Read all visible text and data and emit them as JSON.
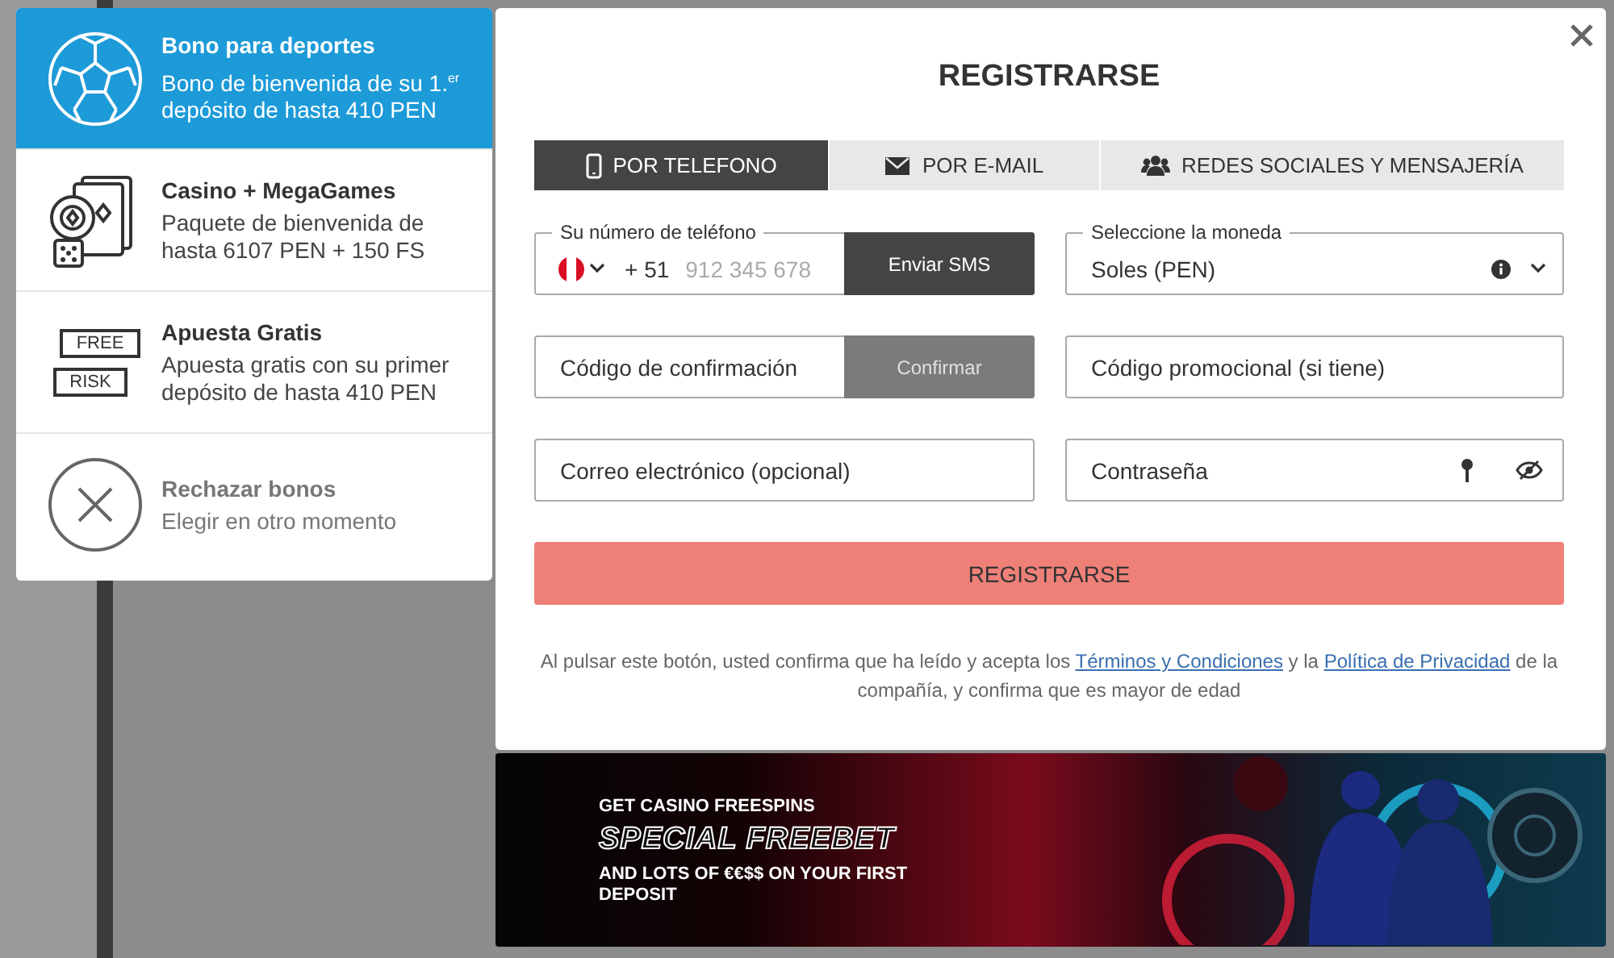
{
  "bonus_options": [
    {
      "kind": "sports",
      "title": "Bono para deportes",
      "description": "Bono de bienvenida de su 1.$^{er}$ depósito de hasta 410 PEN",
      "selected": true
    },
    {
      "kind": "casino",
      "title": "Casino + MegaGames",
      "description": "Paquete de bienvenida de hasta 6107 PEN + 150 FS",
      "selected": false
    },
    {
      "kind": "freebet",
      "title": "Apuesta Gratis",
      "description": "Apuesta gratis con su primer depósito de hasta 410 PEN",
      "selected": false,
      "icon_labels": [
        "FREE",
        "RISK"
      ]
    },
    {
      "kind": "decline",
      "title": "Rechazar bonos",
      "description": "Elegir en otro momento",
      "selected": false
    }
  ],
  "modal": {
    "title": "REGISTRARSE",
    "tabs": [
      {
        "label": "POR TELEFONO",
        "selected": true
      },
      {
        "label": "POR E-MAIL",
        "selected": false
      },
      {
        "label": "REDES SOCIALES Y MENSAJERÍA",
        "selected": false
      }
    ],
    "phone_field": {
      "label": "Su número de teléfono",
      "country_code": "+ 51",
      "placeholder": "912 345 678",
      "button": "Enviar SMS"
    },
    "currency_field": {
      "label": "Seleccione la moneda",
      "value": "Soles (PEN)"
    },
    "confirmation_field": {
      "placeholder": "Código de confirmación",
      "button": "Confirmar",
      "button_disabled": true
    },
    "promo_field": {
      "placeholder": "Código promocional (si tiene)"
    },
    "email_field": {
      "placeholder": "Correo electrónico (opcional)"
    },
    "password_field": {
      "placeholder": "Contraseña"
    },
    "submit": {
      "label": "REGISTRARSE"
    },
    "terms": [
      {
        "kind": "text",
        "text": "Al pulsar este botón, usted confirma que ha leído y acepta los "
      },
      {
        "kind": "link",
        "text": "Términos y Condiciones"
      },
      {
        "kind": "text",
        "text": " y la "
      },
      {
        "kind": "link",
        "text": "Política de Privacidad"
      },
      {
        "kind": "text",
        "text": " de la compañía, y confirma que es mayor de edad"
      }
    ]
  },
  "banner": {
    "kicker": "GET CASINO FREESPINS",
    "headline": "SPECIAL FREEBET",
    "subline": "AND LOTS OF €€$$ ON YOUR FIRST DEPOSIT"
  }
}
